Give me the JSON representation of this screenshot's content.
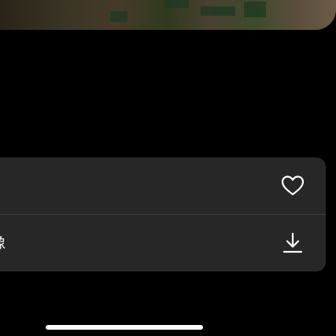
{
  "sheet": {
    "favorite": {
      "label": "",
      "icon": "heart-outline-icon"
    },
    "save": {
      "label": "像",
      "icon": "download-icon"
    }
  },
  "colors": {
    "background": "#000000",
    "sheet_background": "#272727",
    "divider": "#3a3a3c",
    "text": "#ffffff",
    "home_indicator": "#ffffff"
  }
}
